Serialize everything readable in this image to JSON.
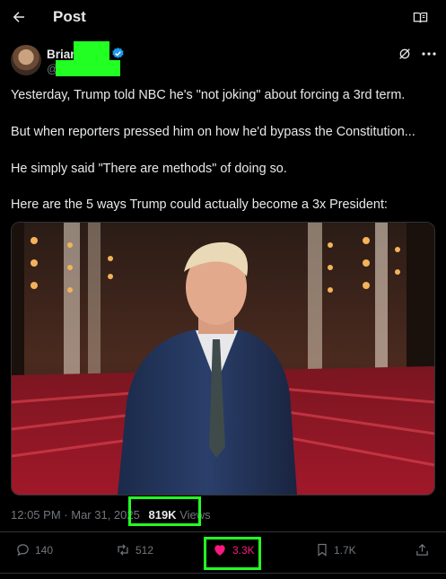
{
  "header": {
    "title": "Post",
    "back_icon": "arrow-left-icon",
    "reader_icon": "book-open-icon"
  },
  "author": {
    "name_visible": "Brian",
    "handle_prefix": "@",
    "verified": true,
    "verified_color": "#1d9bf0"
  },
  "tweet": {
    "paragraphs": [
      "Yesterday, Trump told NBC he's \"not joking\" about forcing a 3rd term.",
      "But when reporters pressed him on how he'd bypass the Constitution...",
      "He simply said \"There are methods\" of doing so.",
      "Here are the 5 ways Trump could actually become a 3x President:"
    ]
  },
  "meta": {
    "time": "12:05 PM",
    "separator": "·",
    "date": "Mar 31, 2025",
    "views_count": "819K",
    "views_label": "Views"
  },
  "actions": {
    "replies": "140",
    "reposts": "512",
    "likes": "3.3K",
    "bookmarks": "1.7K",
    "like_color": "#f91880"
  },
  "colors": {
    "background": "#000000",
    "text": "#e7e9ea",
    "muted": "#71767b",
    "highlight": "#22ff22"
  }
}
